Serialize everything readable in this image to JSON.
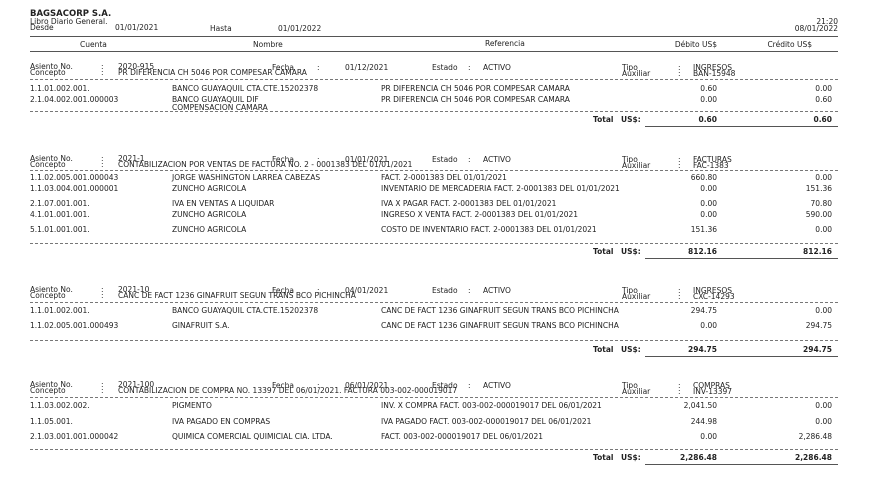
{
  "header": {
    "company": "BAGSACORP S.A.",
    "report": "Libro Diario General.",
    "desde_label": "Desde",
    "desde": "01/01/2021",
    "hasta_label": "Hasta",
    "hasta": "01/01/2022",
    "time": "21:20",
    "print_date": "08/01/2022"
  },
  "columns": {
    "cuenta": "Cuenta",
    "nombre": "Nombre",
    "referencia": "Referencia",
    "debito": "Débito US$",
    "credito": "Crédito US$"
  },
  "labels": {
    "asiento": "Asiento No.",
    "concepto": "Concepto",
    "fecha": "Fecha",
    "estado": "Estado",
    "tipo": "Tipo",
    "auxiliar": "Auxiliar",
    "total": "Total",
    "currency": "US$:",
    "colon": ":"
  },
  "entries": [
    {
      "asiento": "2020-915",
      "fecha": "01/12/2021",
      "estado": "ACTIVO",
      "concepto": "PR DIFERENCIA CH 5046 POR COMPESAR CAMARA",
      "tipo": "INGRESOS",
      "auxiliar": "BAN-15948",
      "lines": [
        {
          "cuenta": "1.1.01.002.001.",
          "nombre": "BANCO GUAYAQUIL CTA.CTE.15202378",
          "referencia": "PR DIFERENCIA CH 5046 POR COMPESAR CAMARA",
          "debito": "0.60",
          "credito": "0.00"
        },
        {
          "cuenta": "2.1.04.002.001.000003",
          "nombre": "BANCO GUAYAQUIL DIF COMPENSACION CAMARA",
          "referencia": "PR DIFERENCIA CH 5046 POR COMPESAR CAMARA",
          "debito": "0.00",
          "credito": "0.60"
        }
      ],
      "total_debito": "0.60",
      "total_credito": "0.60"
    },
    {
      "asiento": "2021-1",
      "fecha": "01/01/2021",
      "estado": "ACTIVO",
      "concepto": "CONTABILIZACION POR VENTAS DE FACTURA NO. 2 - 0001383 DEL 01/01/2021",
      "tipo": "FACTURAS",
      "auxiliar": "FAC-1383",
      "lines": [
        {
          "cuenta": "1.1.02.005.001.000043",
          "nombre": "JORGE WASHINGTON LARREA CABEZAS",
          "referencia": "FACT. 2-0001383 DEL 01/01/2021",
          "debito": "660.80",
          "credito": "0.00"
        },
        {
          "cuenta": "1.1.03.004.001.000001",
          "nombre": "ZUNCHO AGRICOLA",
          "referencia": "INVENTARIO DE MERCADERIA FACT. 2-0001383 DEL 01/01/2021",
          "debito": "0.00",
          "credito": "151.36"
        },
        {
          "cuenta": "2.1.07.001.001.",
          "nombre": "IVA EN VENTAS A LIQUIDAR",
          "referencia": "IVA X PAGAR FACT. 2-0001383 DEL 01/01/2021",
          "debito": "0.00",
          "credito": "70.80"
        },
        {
          "cuenta": "4.1.01.001.001.",
          "nombre": "ZUNCHO AGRICOLA",
          "referencia": "INGRESO X VENTA FACT. 2-0001383 DEL 01/01/2021",
          "debito": "0.00",
          "credito": "590.00"
        },
        {
          "cuenta": "5.1.01.001.001.",
          "nombre": "ZUNCHO AGRICOLA",
          "referencia": "COSTO DE INVENTARIO FACT. 2-0001383 DEL 01/01/2021",
          "debito": "151.36",
          "credito": "0.00"
        }
      ],
      "total_debito": "812.16",
      "total_credito": "812.16"
    },
    {
      "asiento": "2021-10",
      "fecha": "04/01/2021",
      "estado": "ACTIVO",
      "concepto": "CANC DE FACT 1236 GINAFRUIT SEGUN TRANS BCO PICHINCHA",
      "tipo": "INGRESOS",
      "auxiliar": "CXC-14293",
      "lines": [
        {
          "cuenta": "1.1.01.002.001.",
          "nombre": "BANCO GUAYAQUIL CTA.CTE.15202378",
          "referencia": "CANC DE FACT 1236 GINAFRUIT SEGUN TRANS BCO PICHINCHA",
          "debito": "294.75",
          "credito": "0.00"
        },
        {
          "cuenta": "1.1.02.005.001.000493",
          "nombre": "GINAFRUIT S.A.",
          "referencia": "CANC DE FACT 1236 GINAFRUIT SEGUN TRANS BCO PICHINCHA",
          "debito": "0.00",
          "credito": "294.75"
        }
      ],
      "total_debito": "294.75",
      "total_credito": "294.75"
    },
    {
      "asiento": "2021-100",
      "fecha": "06/01/2021",
      "estado": "ACTIVO",
      "concepto": "CONTABILIZACION DE COMPRA NO. 13397 DEL 06/01/2021. FACTURA 003-002-000019017",
      "tipo": "COMPRAS",
      "auxiliar": "INV-13397",
      "lines": [
        {
          "cuenta": "1.1.03.002.002.",
          "nombre": "PIGMENTO",
          "referencia": "INV. X COMPRA FACT. 003-002-000019017 DEL 06/01/2021",
          "debito": "2,041.50",
          "credito": "0.00"
        },
        {
          "cuenta": "1.1.05.001.",
          "nombre": "IVA PAGADO EN COMPRAS",
          "referencia": "IVA PAGADO FACT. 003-002-000019017 DEL 06/01/2021",
          "debito": "244.98",
          "credito": "0.00"
        },
        {
          "cuenta": "2.1.03.001.001.000042",
          "nombre": "QUIMICA COMERCIAL QUIMICIAL CIA. LTDA.",
          "referencia": "FACT. 003-002-000019017 DEL 06/01/2021",
          "debito": "0.00",
          "credito": "2,286.48"
        }
      ],
      "total_debito": "2,286.48",
      "total_credito": "2,286.48"
    }
  ]
}
